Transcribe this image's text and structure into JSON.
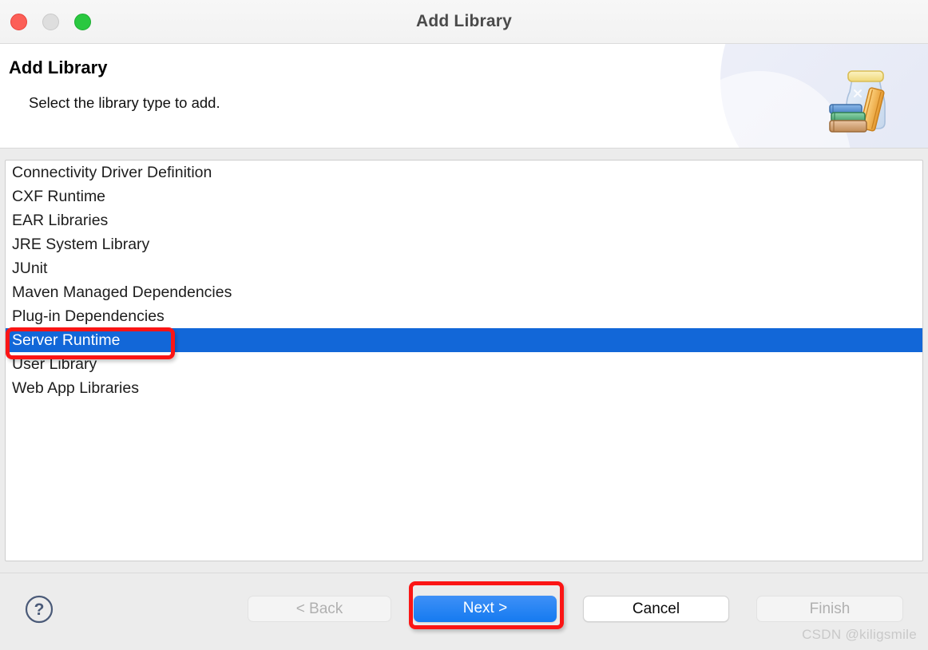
{
  "window": {
    "title": "Add Library",
    "traffic_lights": [
      "close",
      "minimize",
      "maximize"
    ]
  },
  "banner": {
    "title": "Add Library",
    "subtitle": "Select the library type to add.",
    "icon": "jar-with-books-icon"
  },
  "list": {
    "items": [
      {
        "label": "Connectivity Driver Definition",
        "selected": false
      },
      {
        "label": "CXF Runtime",
        "selected": false
      },
      {
        "label": "EAR Libraries",
        "selected": false
      },
      {
        "label": "JRE System Library",
        "selected": false
      },
      {
        "label": "JUnit",
        "selected": false
      },
      {
        "label": "Maven Managed Dependencies",
        "selected": false
      },
      {
        "label": "Plug-in Dependencies",
        "selected": false
      },
      {
        "label": "Server Runtime",
        "selected": true
      },
      {
        "label": "User Library",
        "selected": false
      },
      {
        "label": "Web App Libraries",
        "selected": false
      }
    ],
    "selection_color": "#1267d8"
  },
  "footer": {
    "help_label": "?",
    "buttons": [
      {
        "label": "< Back",
        "state": "disabled"
      },
      {
        "label": "Next >",
        "state": "default"
      },
      {
        "label": "Cancel",
        "state": "normal"
      },
      {
        "label": "Finish",
        "state": "disabled"
      }
    ],
    "watermark": "CSDN @kiligsmile"
  },
  "annotations": {
    "highlight_color": "#fb1515",
    "boxes": [
      "server-runtime-row",
      "next-button"
    ]
  }
}
